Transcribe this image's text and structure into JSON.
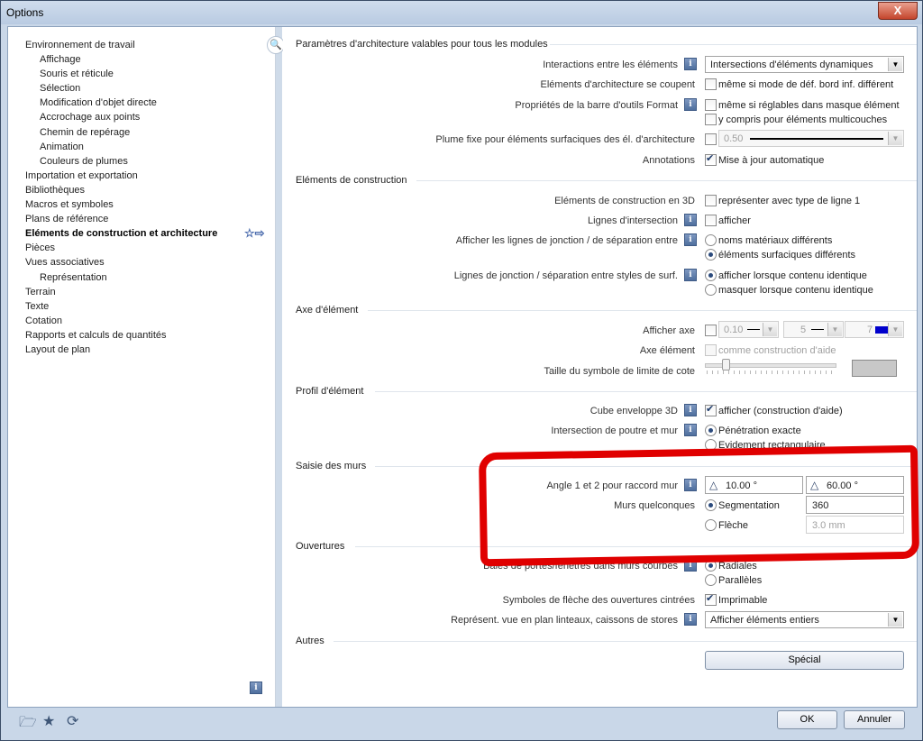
{
  "window": {
    "title": "Options",
    "close_label": "X"
  },
  "tree": [
    {
      "label": "Environnement de travail",
      "level": 0
    },
    {
      "label": "Affichage",
      "level": 1
    },
    {
      "label": "Souris et réticule",
      "level": 1
    },
    {
      "label": "Sélection",
      "level": 1
    },
    {
      "label": "Modification d'objet directe",
      "level": 1
    },
    {
      "label": "Accrochage aux points",
      "level": 1
    },
    {
      "label": "Chemin de repérage",
      "level": 1
    },
    {
      "label": "Animation",
      "level": 1
    },
    {
      "label": "Couleurs de plumes",
      "level": 1
    },
    {
      "label": "Importation et exportation",
      "level": 0
    },
    {
      "label": "Bibliothèques",
      "level": 0
    },
    {
      "label": "Macros et symboles",
      "level": 0
    },
    {
      "label": "Plans de référence",
      "level": 0
    },
    {
      "label": "Eléments de construction et architecture",
      "level": 0,
      "selected": true
    },
    {
      "label": "Pièces",
      "level": 0
    },
    {
      "label": "Vues associatives",
      "level": 0
    },
    {
      "label": "Représentation",
      "level": 1
    },
    {
      "label": "Terrain",
      "level": 0
    },
    {
      "label": "Texte",
      "level": 0
    },
    {
      "label": "Cotation",
      "level": 0
    },
    {
      "label": "Rapports et calculs de quantités",
      "level": 0
    },
    {
      "label": "Layout de plan",
      "level": 0
    }
  ],
  "sections": {
    "arch": "Paramètres d'architecture valables pour tous les modules",
    "construction": "Eléments de construction",
    "axe": "Axe d'élément",
    "profil": "Profil d'élément",
    "murs": "Saisie des murs",
    "ouvertures": "Ouvertures",
    "autres": "Autres"
  },
  "arch": {
    "interactions_label": "Interactions entre les éléments",
    "interactions_value": "Intersections d'éléments dynamiques",
    "coupent_label": "Eléments d'architecture se coupent",
    "coupent_option": "même si mode de déf. bord inf. différent",
    "format_label": "Propriétés de la barre d'outils Format",
    "format_option1": "même si réglables dans masque élément",
    "format_option2": "y compris pour éléments multicouches",
    "plume_label": "Plume fixe pour éléments surfaciques des él. d'architecture",
    "plume_value": "0.50",
    "annotations_label": "Annotations",
    "annotations_option": "Mise à jour automatique"
  },
  "construction": {
    "3d_label": "Eléments de construction en 3D",
    "3d_option": "représenter avec type de ligne 1",
    "lignes_label": "Lignes d'intersection",
    "lignes_option": "afficher",
    "jonction_label": "Afficher les lignes de jonction / de séparation entre",
    "jonction_opt1": "noms matériaux différents",
    "jonction_opt2": "éléments surfaciques différents",
    "styles_label": "Lignes de jonction / séparation entre styles de surf.",
    "styles_opt1": "afficher lorsque contenu identique",
    "styles_opt2": "masquer lorsque contenu identique"
  },
  "axe": {
    "afficher_label": "Afficher axe",
    "pen_value": "0.10",
    "line_value": "5",
    "color_value": "7",
    "element_label": "Axe élément",
    "element_option": "comme construction d'aide",
    "taille_label": "Taille du symbole de limite de cote"
  },
  "profil": {
    "cube_label": "Cube enveloppe 3D",
    "cube_option": "afficher (construction d'aide)",
    "poutre_label": "Intersection de poutre et mur",
    "poutre_opt1": "Pénétration exacte",
    "poutre_opt2": "Evidement rectangulaire"
  },
  "murs": {
    "angle_label": "Angle 1 et 2 pour raccord mur",
    "angle1": "10.00 °",
    "angle2": "60.00 °",
    "quelconques_label": "Murs quelconques",
    "segmentation_label": "Segmentation",
    "segmentation_value": "360",
    "fleche_label": "Flèche",
    "fleche_value": "3.0 mm"
  },
  "ouvertures": {
    "baies_label": "Baies de portes/fenêtres dans murs courbes",
    "baies_opt1": "Radiales",
    "baies_opt2": "Parallèles",
    "symboles_label": "Symboles de flèche des ouvertures cintrées",
    "symboles_option": "Imprimable",
    "linteaux_label": "Représent. vue en plan linteaux, caissons de stores",
    "linteaux_value": "Afficher éléments entiers"
  },
  "autres": {
    "special_label": "Spécial"
  },
  "buttons": {
    "ok": "OK",
    "cancel": "Annuler"
  },
  "icons": {
    "info": "i",
    "search": "search-icon",
    "favorite": "favorite-star-icon"
  },
  "colors": {
    "accent": "#3f5b86",
    "annotation": "#e00000",
    "axis_color": "#0000cc"
  }
}
